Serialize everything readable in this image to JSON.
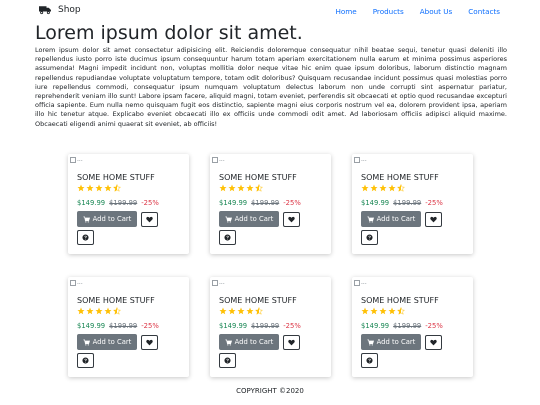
{
  "navbar": {
    "brand_icon": "truck-icon",
    "brand": "Shop",
    "links": [
      "Home",
      "Products",
      "About Us",
      "Contacts"
    ]
  },
  "main": {
    "title": "Lorem ipsum dolor sit amet.",
    "intro": "Lorem ipsum dolor sit amet consectetur adipisicing elit. Reiciendis doloremque consequatur nihil beatae sequi, tenetur quasi deleniti illo repellendus iusto porro iste ducimus ipsum consequuntur harum totam aperiam exercitationem nulla earum et minima possimus asperiores assumenda! Magni impedit incidunt non, voluptas mollitia dolor neque vitae hic enim quae ipsum doloribus, laborum distinctio magnam repellendus repudiandae voluptate voluptatum tempore, totam odit doloribus? Quisquam recusandae incidunt possimus quasi molestias porro iure repellendus commodi, consequatur ipsum numquam voluptatum delectus laborum non unde corrupti sint aspernatur pariatur, reprehenderit veniam illo sunt! Labore ipsam facere, aliquid magni, totam eveniet, perferendis sit obcaecati et optio quod recusandae excepturi officia sapiente. Eum nulla nemo quisquam fugit eos distinctio, sapiente magni eius corporis nostrum vel ea, dolorem provident ipsa, aperiam illo hic tenetur atque. Explicabo eveniet obcaecati illo ex officiis unde commodi odit amet. Ad laboriosam officiis adipisci aliquid maxime. Obcaecati eligendi animi quaerat sit eveniet, ab officiis!"
  },
  "products": [
    {
      "img_alt": "...",
      "name": "SOME HOME STUFF",
      "rating": 4.5,
      "rating_max": 5,
      "price": "$149.99",
      "old_price": "$199.99",
      "discount": "-25%",
      "add_label": "Add to Cart"
    },
    {
      "img_alt": "...",
      "name": "SOME HOME STUFF",
      "rating": 4.5,
      "rating_max": 5,
      "price": "$149.99",
      "old_price": "$199.99",
      "discount": "-25%",
      "add_label": "Add to Cart"
    },
    {
      "img_alt": "...",
      "name": "SOME HOME STUFF",
      "rating": 4.5,
      "rating_max": 5,
      "price": "$149.99",
      "old_price": "$199.99",
      "discount": "-25%",
      "add_label": "Add to Cart"
    },
    {
      "img_alt": "...",
      "name": "SOME HOME STUFF",
      "rating": 4.5,
      "rating_max": 5,
      "price": "$149.99",
      "old_price": "$199.99",
      "discount": "-25%",
      "add_label": "Add to Cart"
    },
    {
      "img_alt": "...",
      "name": "SOME HOME STUFF",
      "rating": 4.5,
      "rating_max": 5,
      "price": "$149.99",
      "old_price": "$199.99",
      "discount": "-25%",
      "add_label": "Add to Cart"
    },
    {
      "img_alt": "...",
      "name": "SOME HOME STUFF",
      "rating": 4.5,
      "rating_max": 5,
      "price": "$149.99",
      "old_price": "$199.99",
      "discount": "-25%",
      "add_label": "Add to Cart"
    }
  ],
  "icons": {
    "cart": "cart-icon",
    "favorite": "heart-icon",
    "help": "question-circle-icon",
    "star": "star-icon"
  },
  "colors": {
    "link": "#0d6efd",
    "price": "#198754",
    "discount": "#dc3545",
    "star": "#ffc107",
    "button": "#6c757d"
  },
  "footer": {
    "copyright": "COPYRIGHT ©2020"
  }
}
